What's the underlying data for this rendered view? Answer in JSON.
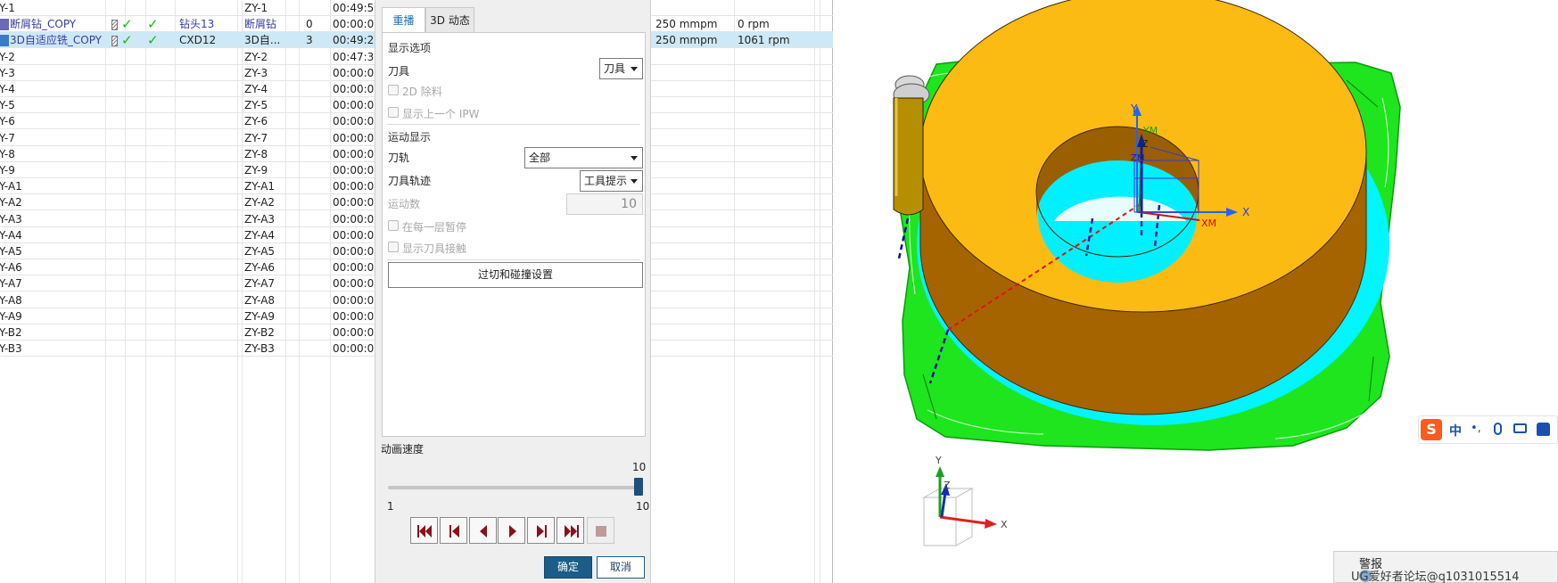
{
  "operations": {
    "rows": [
      {
        "name": "Y-1",
        "program": "ZY-1",
        "time": "00:49:5",
        "has_checks": false,
        "selected": false
      },
      {
        "name": "断屑钻_COPY",
        "tool": "钻头13",
        "tool_num": "0",
        "program": "断屑钻",
        "time": "00:00:0",
        "feed": "250 mmpm",
        "speed": "0 rpm",
        "has_checks": true,
        "selected": false
      },
      {
        "name": "3D自适应铣_COPY",
        "tool": "CXD12",
        "tool_num": "3",
        "program": "3D自...",
        "time": "00:49:2",
        "feed": "250 mmpm",
        "speed": "1061 rpm",
        "has_checks": true,
        "selected": true
      },
      {
        "name": "Y-2",
        "program": "ZY-2",
        "time": "00:47:3",
        "has_checks": false,
        "selected": false
      },
      {
        "name": "Y-3",
        "program": "ZY-3",
        "time": "00:00:0",
        "has_checks": false,
        "selected": false
      },
      {
        "name": "Y-4",
        "program": "ZY-4",
        "time": "00:00:0",
        "has_checks": false,
        "selected": false
      },
      {
        "name": "Y-5",
        "program": "ZY-5",
        "time": "00:00:0",
        "has_checks": false,
        "selected": false
      },
      {
        "name": "Y-6",
        "program": "ZY-6",
        "time": "00:00:0",
        "has_checks": false,
        "selected": false
      },
      {
        "name": "Y-7",
        "program": "ZY-7",
        "time": "00:00:0",
        "has_checks": false,
        "selected": false
      },
      {
        "name": "Y-8",
        "program": "ZY-8",
        "time": "00:00:0",
        "has_checks": false,
        "selected": false
      },
      {
        "name": "Y-9",
        "program": "ZY-9",
        "time": "00:00:0",
        "has_checks": false,
        "selected": false
      },
      {
        "name": "Y-A1",
        "program": "ZY-A1",
        "time": "00:00:0",
        "has_checks": false,
        "selected": false
      },
      {
        "name": "Y-A2",
        "program": "ZY-A2",
        "time": "00:00:0",
        "has_checks": false,
        "selected": false
      },
      {
        "name": "Y-A3",
        "program": "ZY-A3",
        "time": "00:00:0",
        "has_checks": false,
        "selected": false
      },
      {
        "name": "Y-A4",
        "program": "ZY-A4",
        "time": "00:00:0",
        "has_checks": false,
        "selected": false
      },
      {
        "name": "Y-A5",
        "program": "ZY-A5",
        "time": "00:00:0",
        "has_checks": false,
        "selected": false
      },
      {
        "name": "Y-A6",
        "program": "ZY-A6",
        "time": "00:00:0",
        "has_checks": false,
        "selected": false
      },
      {
        "name": "Y-A7",
        "program": "ZY-A7",
        "time": "00:00:0",
        "has_checks": false,
        "selected": false
      },
      {
        "name": "Y-A8",
        "program": "ZY-A8",
        "time": "00:00:0",
        "has_checks": false,
        "selected": false
      },
      {
        "name": "Y-A9",
        "program": "ZY-A9",
        "time": "00:00:0",
        "has_checks": false,
        "selected": false
      },
      {
        "name": "Y-B2",
        "program": "ZY-B2",
        "time": "00:00:0",
        "has_checks": false,
        "selected": false
      },
      {
        "name": "Y-B3",
        "program": "ZY-B3",
        "time": "00:00:0",
        "has_checks": false,
        "selected": false
      }
    ],
    "check_glyph": "✓"
  },
  "dialog": {
    "tabs": [
      {
        "label": "重播",
        "active": true
      },
      {
        "label": "3D 动态",
        "active": false
      }
    ],
    "display_options": {
      "title": "显示选项",
      "tool_label": "刀具",
      "tool_value": "刀具",
      "removal_2d": "2D 除料",
      "show_prev_ipw": "显示上一个 IPW"
    },
    "motion_display": {
      "title": "运动显示",
      "toolpath_label": "刀轨",
      "toolpath_value": "全部",
      "tool_trace_label": "刀具轨迹",
      "tool_trace_value": "工具提示",
      "motion_count_label": "运动数",
      "motion_count_value": "10",
      "pause_each_layer": "在每一层暂停",
      "show_tool_contact": "显示刀具接触"
    },
    "gouge_button": "过切和碰撞设置",
    "animation": {
      "title": "动画速度",
      "current": "10",
      "min": "1",
      "max": "10",
      "level": 1.0
    },
    "ok_label": "确定",
    "cancel_label": "取消"
  },
  "viewport": {
    "axis_labels": {
      "x": "X",
      "y": "Y",
      "z": "Z",
      "xm": "XM",
      "ym": "YM",
      "zm": "ZM"
    },
    "colors": {
      "part": "#fbbb12",
      "part_side": "#a86700",
      "toolpath": "#19f019",
      "stock": "#00ffff",
      "tool": "#c49c00"
    },
    "ime_label": "中",
    "warning_title": "警报",
    "watermark": "UG爱好者论坛@q1031015514"
  }
}
